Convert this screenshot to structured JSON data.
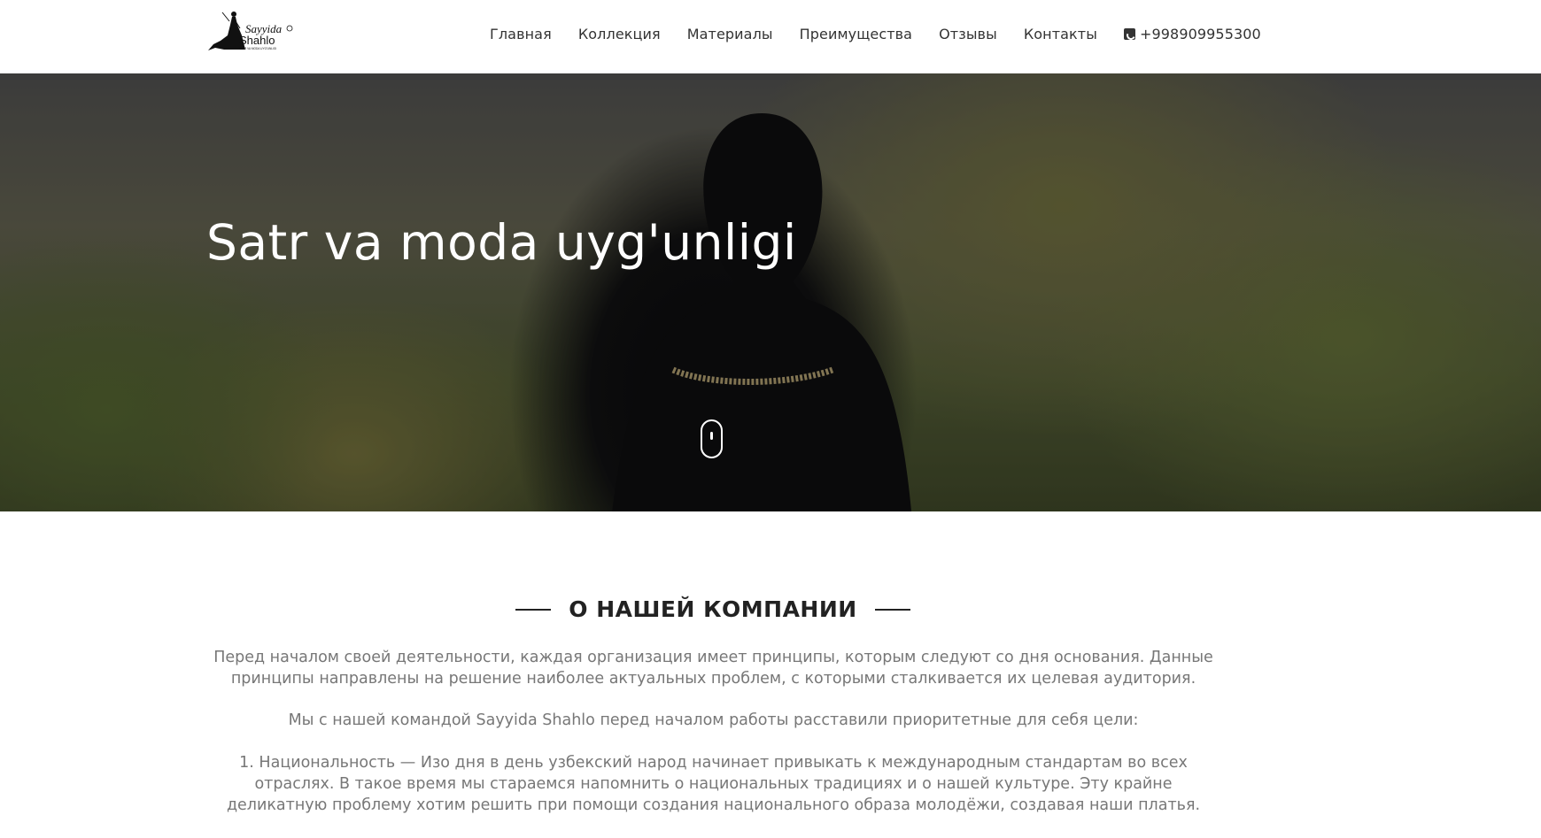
{
  "header": {
    "logo": {
      "brand_line1": "Sayyida",
      "brand_line2": "Shahlo",
      "tagline": "SATR VA MODA UYG'UNLIGI"
    },
    "nav": [
      {
        "label": "Главная"
      },
      {
        "label": "Коллекция"
      },
      {
        "label": "Материалы"
      },
      {
        "label": "Преимущества"
      },
      {
        "label": "Отзывы"
      },
      {
        "label": "Контакты"
      }
    ],
    "phone": "+998909955300",
    "phone_icon": "phone-square-icon"
  },
  "hero": {
    "title": "Satr va moda uyg'unligi",
    "scroll_icon": "mouse-scroll-icon"
  },
  "about": {
    "title": "О НАШЕЙ КОМПАНИИ",
    "paragraph1": "Перед началом своей деятельности, каждая организация имеет принципы, которым следуют со дня основания. Данные принципы направлены на решение наиболее актуальных проблем, с которыми сталкивается их целевая аудитория.",
    "paragraph2": "Мы с нашей командой Sayyida Shahlo перед началом работы расставили приоритетные для себя цели:",
    "paragraph3": "1. Национальность — Изо дня в день узбекский народ начинает привыкать к международным стандартам во всех отраслях. В такое время мы стараемся напомнить о национальных традициях и о нашей культуре. Эту крайне деликатную проблему хотим решить при помощи создания национального образа молодёжи, создавая наши платья."
  },
  "colors": {
    "header_bg": "#ffffff",
    "nav_text": "#333333",
    "hero_title": "#ffffff",
    "about_title": "#222222",
    "about_text": "#777777"
  }
}
